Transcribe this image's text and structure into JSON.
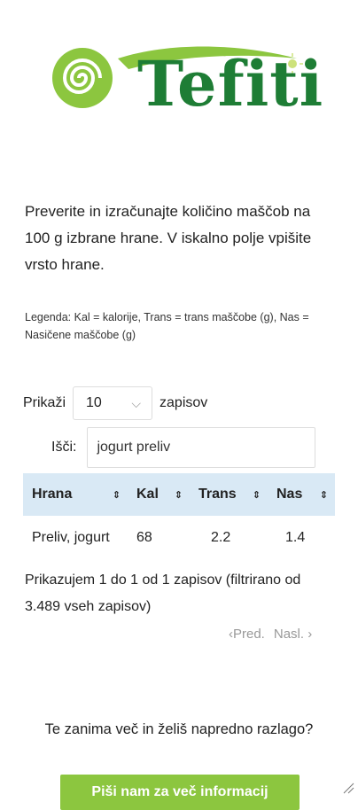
{
  "brand": {
    "name": "Tefiti"
  },
  "intro": "Preverite in izračunajte količino maščob na 100 g izbrane hrane. V iskalno polje vpišite vrsto hrane.",
  "legend": "Legenda: Kal = kalorije, Trans = trans maščobe (g), Nas = Nasičene maščobe (g)",
  "controls": {
    "show_label": "Prikaži",
    "show_value": "10",
    "show_suffix": "zapisov",
    "search_label": "Išči:",
    "search_value": "jogurt preliv"
  },
  "table": {
    "headers": [
      "Hrana",
      "Kal",
      "Trans",
      "Nas"
    ],
    "rows": [
      [
        "Preliv, jogurt",
        "68",
        "2.2",
        "1.4"
      ]
    ]
  },
  "info": "Prikazujem 1 do 1 od 1 zapisov (filtrirano od 3.489 vseh zapisov)",
  "pager": {
    "prev": "‹Pred.",
    "next": "Nasl. ›"
  },
  "question": "Te zanima več in želiš napredno razlago?",
  "cta": "Piši nam za več informacij",
  "colors": {
    "brand_green": "#1e7d35",
    "accent_green": "#8cc63f",
    "header_blue": "#d9e9f5"
  }
}
